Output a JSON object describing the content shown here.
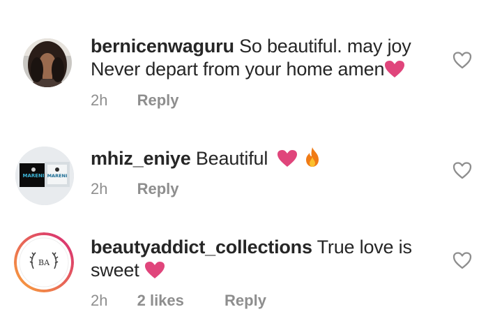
{
  "comments": [
    {
      "username": "bernicenwaguru",
      "text_line1": "So beautiful. may joy",
      "text_line2": "Never depart from your home amen",
      "time": "2h",
      "reply": "Reply",
      "avatar_icon": "profile-photo-woman-icon",
      "like_icon": "heart-outline-icon"
    },
    {
      "username": "mhiz_eniye",
      "text": "Beautiful",
      "time": "2h",
      "reply": "Reply",
      "avatar_brand": "MARENI",
      "like_icon": "heart-outline-icon"
    },
    {
      "username": "beautyaddict_collections",
      "text_line1": "True love is",
      "text_line2": "sweet",
      "time": "2h",
      "likes": "2 likes",
      "reply": "Reply",
      "avatar_monogram": "BA",
      "like_icon": "heart-outline-icon"
    }
  ],
  "colors": {
    "text": "#262626",
    "meta": "#8e8e8e",
    "heart_emoji": "#e0457b",
    "fire": "#f07b16",
    "story_ring_start": "#f9a23a",
    "story_ring_end": "#d62976"
  }
}
